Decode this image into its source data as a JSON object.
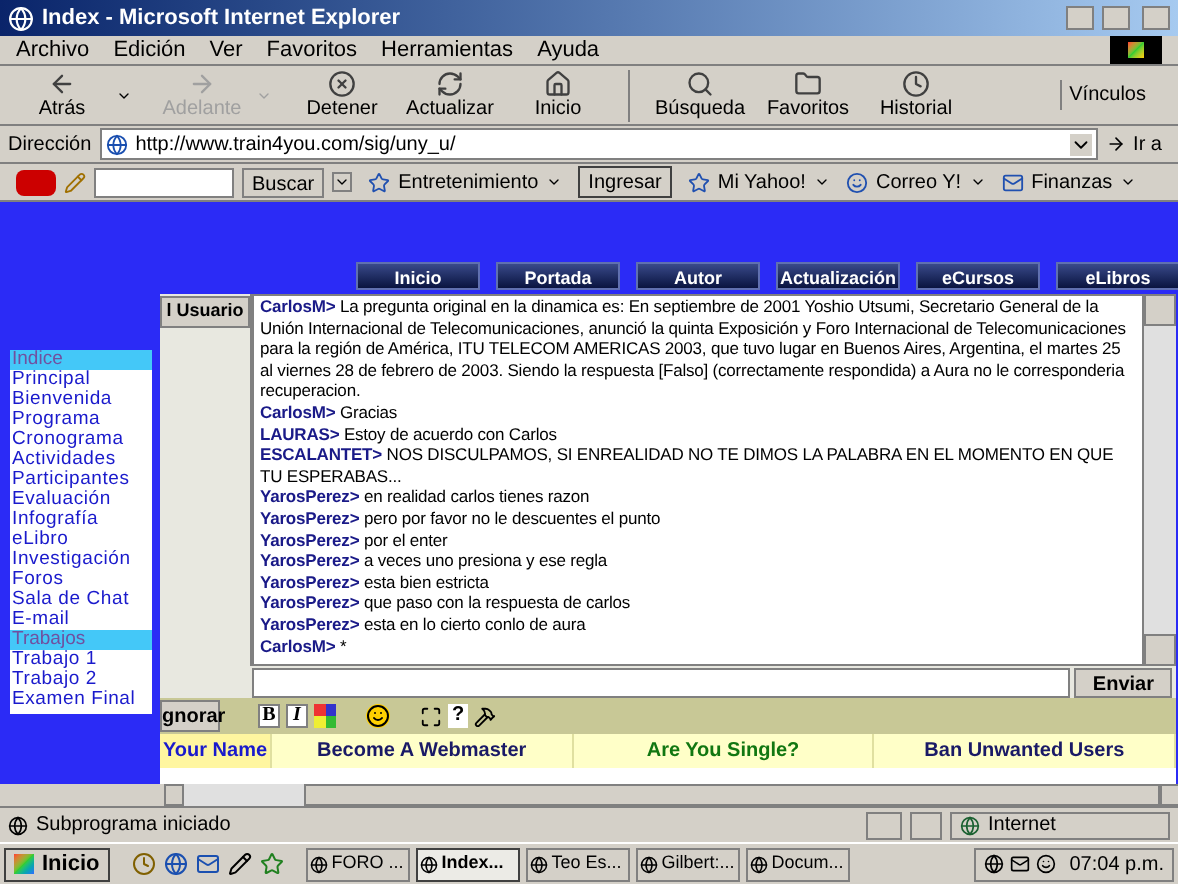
{
  "window": {
    "title": "Index - Microsoft Internet Explorer"
  },
  "menu": [
    "Archivo",
    "Edición",
    "Ver",
    "Favoritos",
    "Herramientas",
    "Ayuda"
  ],
  "toolbar": [
    {
      "label": "Atrás",
      "disabled": false,
      "dropdown": true
    },
    {
      "label": "Adelante",
      "disabled": true,
      "dropdown": true
    },
    {
      "label": "Detener",
      "disabled": false,
      "dropdown": false
    },
    {
      "label": "Actualizar",
      "disabled": false,
      "dropdown": false
    },
    {
      "label": "Inicio",
      "disabled": false,
      "dropdown": false
    },
    {
      "label": "Búsqueda",
      "disabled": false,
      "dropdown": false
    },
    {
      "label": "Favoritos",
      "disabled": false,
      "dropdown": false
    },
    {
      "label": "Historial",
      "disabled": false,
      "dropdown": false
    }
  ],
  "links_label": "Vínculos",
  "address": {
    "label": "Dirección",
    "value": "http://www.train4you.com/sig/uny_u/",
    "go": "Ir a"
  },
  "yahoo_bar": {
    "search_button": "Buscar",
    "items": [
      {
        "label": "Entretenimiento",
        "kind": "menu"
      },
      {
        "label": "Ingresar",
        "kind": "button"
      },
      {
        "label": "Mi Yahoo!",
        "kind": "menu"
      },
      {
        "label": "Correo Y!",
        "kind": "menu"
      },
      {
        "label": "Finanzas",
        "kind": "menu"
      }
    ]
  },
  "nav_buttons": [
    "Inicio",
    "Portada",
    "Autor",
    "Actualización",
    "eCursos",
    "eLibros"
  ],
  "side_menu": [
    {
      "label": "Indice",
      "kind": "header"
    },
    {
      "label": "Principal",
      "kind": "link"
    },
    {
      "label": "Bienvenida",
      "kind": "link"
    },
    {
      "label": "Programa",
      "kind": "link"
    },
    {
      "label": "Cronograma",
      "kind": "link"
    },
    {
      "label": "Actividades",
      "kind": "link"
    },
    {
      "label": "Participantes",
      "kind": "link"
    },
    {
      "label": "Evaluación",
      "kind": "link"
    },
    {
      "label": "Infografía",
      "kind": "link"
    },
    {
      "label": "eLibro",
      "kind": "link"
    },
    {
      "label": "Investigación",
      "kind": "link"
    },
    {
      "label": "Foros",
      "kind": "link"
    },
    {
      "label": "Sala de Chat",
      "kind": "link"
    },
    {
      "label": "E-mail",
      "kind": "link"
    },
    {
      "label": "Trabajos",
      "kind": "header"
    },
    {
      "label": "Trabajo 1",
      "kind": "link"
    },
    {
      "label": "Trabajo 2",
      "kind": "link"
    },
    {
      "label": "Examen Final",
      "kind": "link"
    }
  ],
  "users_button": "l Usuario",
  "chat": [
    {
      "user": "CarlosM>",
      "text": "La pregunta original en la dinamica es: En septiembre de 2001 Yoshio Utsumi, Secretario General de la Unión Internacional de Telecomunicaciones, anunció la quinta Exposición y Foro Internacional de Telecomunicaciones para la región de América, ITU TELECOM AMERICAS 2003, que tuvo lugar en Buenos Aires, Argentina, el martes 25 al viernes 28 de febrero de 2003. Siendo la respuesta [Falso] (correctamente respondida) a Aura no le corresponderia recuperacion."
    },
    {
      "user": "CarlosM>",
      "text": "Gracias"
    },
    {
      "user": "LAURAS>",
      "text": "Estoy de acuerdo con Carlos"
    },
    {
      "user": "ESCALANTET>",
      "text": "NOS DISCULPAMOS, SI ENREALIDAD NO TE DIMOS LA PALABRA EN EL MOMENTO EN QUE TU ESPERABAS..."
    },
    {
      "user": "YarosPerez>",
      "text": "en realidad carlos tienes razon"
    },
    {
      "user": "YarosPerez>",
      "text": "pero por favor no le descuentes el punto"
    },
    {
      "user": "YarosPerez>",
      "text": "por el enter"
    },
    {
      "user": "YarosPerez>",
      "text": "a veces uno presiona y ese regla"
    },
    {
      "user": "YarosPerez>",
      "text": "esta bien estricta"
    },
    {
      "user": "YarosPerez>",
      "text": "que paso con la respuesta de carlos"
    },
    {
      "user": "YarosPerez>",
      "text": "esta en lo cierto conlo de aura"
    },
    {
      "user": "CarlosM>",
      "text": "*"
    }
  ],
  "send_button": "Enviar",
  "ignore_button": "gnorar",
  "format_tools": [
    "B",
    "I",
    "?"
  ],
  "ads": [
    "Your Name",
    "Become A Webmaster",
    "Are You Single?",
    "Ban Unwanted Users"
  ],
  "status_bar": {
    "text": "Subprograma iniciado",
    "zone": "Internet"
  },
  "taskbar": {
    "start": "Inicio",
    "tasks": [
      {
        "label": "FORO ...",
        "selected": false
      },
      {
        "label": "Index...",
        "selected": true
      },
      {
        "label": "Teo Es...",
        "selected": false
      },
      {
        "label": "Gilbert:...",
        "selected": false
      },
      {
        "label": "Docum...",
        "selected": false
      }
    ],
    "clock": "07:04 p.m."
  }
}
